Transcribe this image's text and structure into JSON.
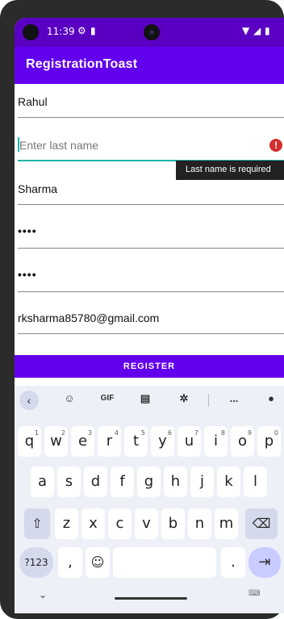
{
  "status_bar": {
    "time": "11:39",
    "icons": [
      "settings-icon",
      "sd-card-icon",
      "wifi-icon",
      "signal-icon",
      "battery-icon"
    ]
  },
  "app_bar": {
    "title": "RegistrationToast"
  },
  "form": {
    "first_name": {
      "value": "Rahul"
    },
    "last_name": {
      "placeholder": "Enter last name",
      "value": "",
      "error": "Last name is required"
    },
    "third_field": {
      "value": "Sharma"
    },
    "password": {
      "value": "••••"
    },
    "confirm_password": {
      "value": "••••"
    },
    "email": {
      "value": "rksharma85780@gmail.com"
    }
  },
  "register_button": {
    "label": "REGISTER"
  },
  "keyboard": {
    "toolbar": {
      "gif_label": "GIF",
      "more_label": "..."
    },
    "row1": [
      {
        "k": "q",
        "n": "1"
      },
      {
        "k": "w",
        "n": "2"
      },
      {
        "k": "e",
        "n": "3"
      },
      {
        "k": "r",
        "n": "4"
      },
      {
        "k": "t",
        "n": "5"
      },
      {
        "k": "y",
        "n": "6"
      },
      {
        "k": "u",
        "n": "7"
      },
      {
        "k": "i",
        "n": "8"
      },
      {
        "k": "o",
        "n": "9"
      },
      {
        "k": "p",
        "n": "0"
      }
    ],
    "row2": [
      "a",
      "s",
      "d",
      "f",
      "g",
      "h",
      "j",
      "k",
      "l"
    ],
    "row3": [
      "z",
      "x",
      "c",
      "v",
      "b",
      "n",
      "m"
    ],
    "sym_label": "?123",
    "comma": ",",
    "period": "."
  },
  "colors": {
    "app_bar": "#6200ee",
    "status_bar": "#5a00c2",
    "focus_underline": "#20b3a8",
    "error": "#d32f2f"
  }
}
